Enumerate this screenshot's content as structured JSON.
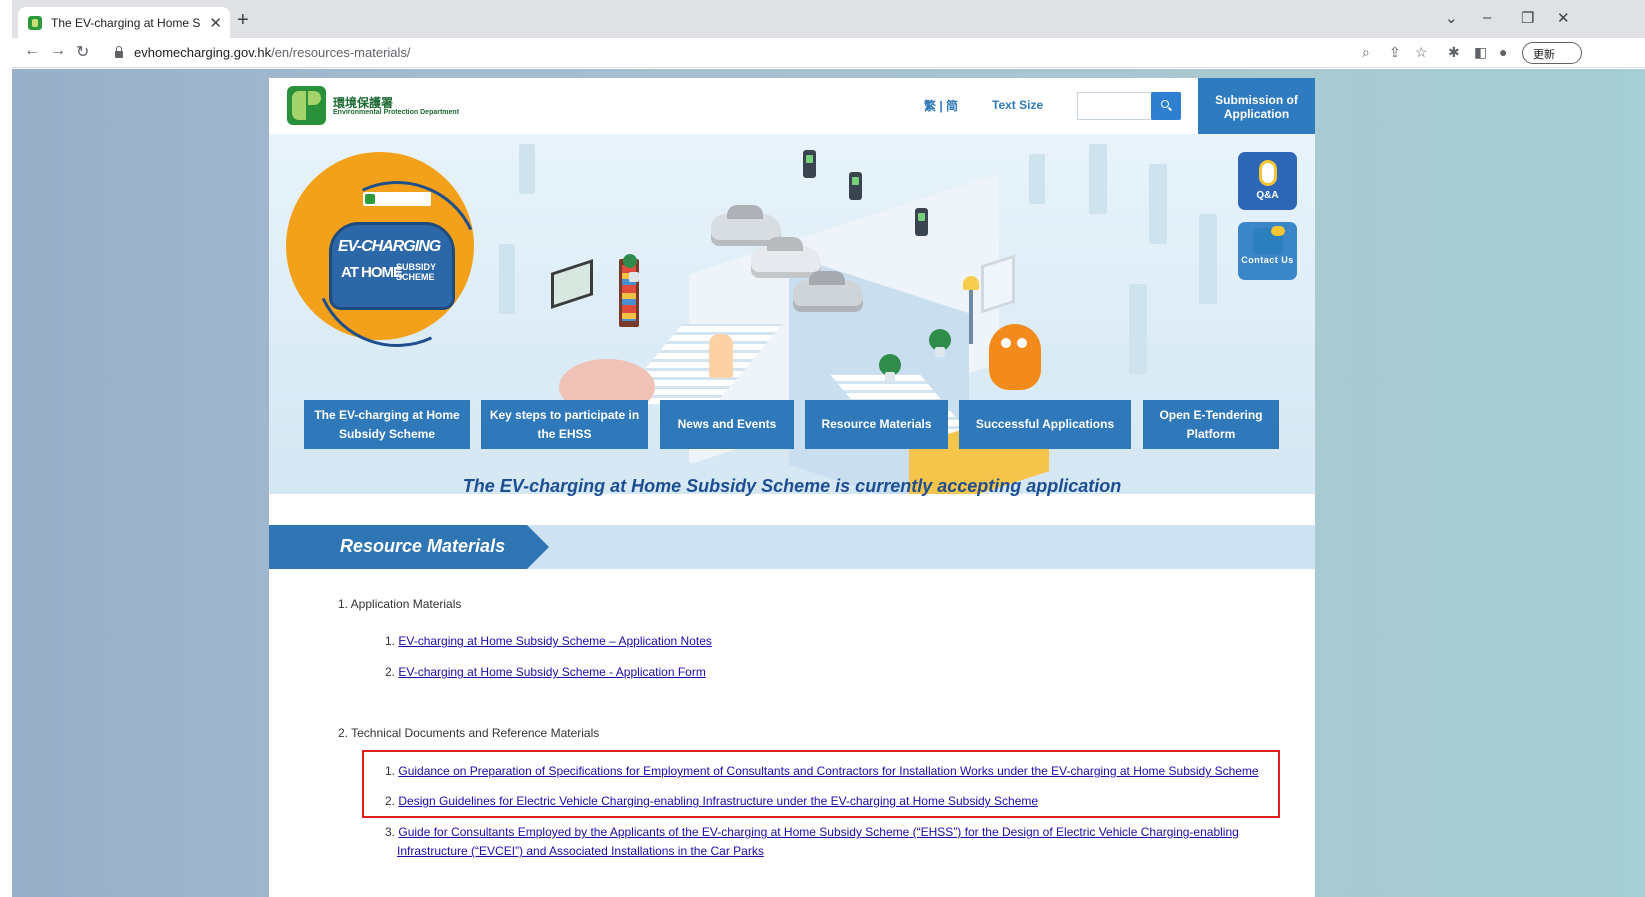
{
  "browser": {
    "tab_title": "The EV-charging at Home Sub:",
    "url_host": "evhomecharging.gov.hk",
    "url_path": "/en/resources-materials/",
    "update_label": "更新"
  },
  "header": {
    "logo_cn": "環境保護署",
    "logo_en": "Environmental Protection Department",
    "lang_switch": "繁 | 简",
    "text_size": "Text Size",
    "search_placeholder": "",
    "submission_label": "Submission of Application"
  },
  "hero": {
    "badge_line1": "EV-CHARGING",
    "badge_line2": "AT HOME",
    "badge_line3": "SUBSIDY SCHEME"
  },
  "side_buttons": {
    "qa_label": "Q&A",
    "contact_label": "Contact Us"
  },
  "nav": [
    {
      "label": "The EV-charging at Home Subsidy Scheme"
    },
    {
      "label": "Key steps to participate in the EHSS"
    },
    {
      "label": "News and Events"
    },
    {
      "label": "Resource Materials"
    },
    {
      "label": "Successful Applications"
    },
    {
      "label": "Open E-Tendering Platform"
    }
  ],
  "headline": "The EV-charging at Home Subsidy Scheme is currently accepting application",
  "section_title": "Resource Materials",
  "materials": {
    "group1_title": "1. Application Materials",
    "group1_items": [
      {
        "num": "1.",
        "label": "EV-charging at Home Subsidy Scheme – Application Notes"
      },
      {
        "num": "2.",
        "label": "EV-charging at Home Subsidy Scheme - Application Form"
      }
    ],
    "group2_title": "2. Technical Documents and Reference Materials",
    "group2_items": [
      {
        "num": "1.",
        "label": "Guidance on Preparation of Specifications for Employment of Consultants and Contractors for Installation Works under the EV-charging at Home Subsidy Scheme"
      },
      {
        "num": "2.",
        "label": "Design Guidelines for Electric Vehicle Charging-enabling Infrastructure under the EV-charging at Home Subsidy Scheme"
      },
      {
        "num": "3.",
        "label": "Guide for Consultants Employed by the Applicants of the EV-charging at Home Subsidy Scheme (“EHSS”) for the Design of Electric Vehicle Charging-enabling",
        "label_cont": "Infrastructure (“EVCEI”) and Associated Installations in the Car Parks"
      }
    ]
  }
}
